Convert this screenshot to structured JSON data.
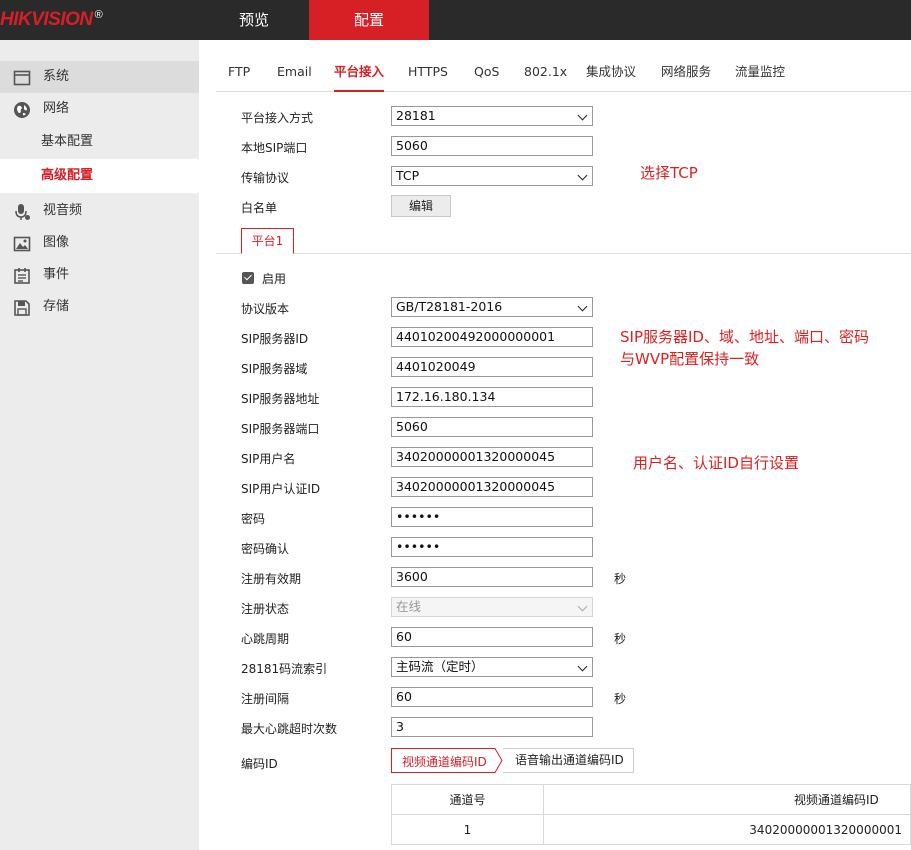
{
  "header": {
    "logo": "HIKVISION",
    "logo_mark": "®",
    "tabs": [
      {
        "label": "预览"
      },
      {
        "label": "配置"
      }
    ]
  },
  "sidebar": {
    "items": [
      {
        "label": "系统",
        "icon": "window-icon"
      },
      {
        "label": "网络",
        "icon": "globe-icon"
      },
      {
        "label": "基本配置"
      },
      {
        "label": "高级配置"
      },
      {
        "label": "视音频",
        "icon": "microphone-icon"
      },
      {
        "label": "图像",
        "icon": "image-icon"
      },
      {
        "label": "事件",
        "icon": "calendar-icon"
      },
      {
        "label": "存储",
        "icon": "floppy-disk-icon"
      }
    ]
  },
  "subtabs": [
    "FTP",
    "Email",
    "平台接入",
    "HTTPS",
    "QoS",
    "802.1x",
    "集成协议",
    "网络服务",
    "流量监控"
  ],
  "form": {
    "access_mode": {
      "label": "平台接入方式",
      "value": "28181"
    },
    "local_sip_port": {
      "label": "本地SIP端口",
      "value": "5060"
    },
    "transport": {
      "label": "传输协议",
      "value": "TCP"
    },
    "whitelist": {
      "label": "白名单",
      "button": "编辑"
    },
    "platform_tab": "平台1",
    "enable": {
      "label": "启用"
    },
    "protocol_version": {
      "label": "协议版本",
      "value": "GB/T28181-2016"
    },
    "sip_server_id": {
      "label": "SIP服务器ID",
      "value": "44010200492000000001"
    },
    "sip_server_domain": {
      "label": "SIP服务器域",
      "value": "4401020049"
    },
    "sip_server_address": {
      "label": "SIP服务器地址",
      "value": "172.16.180.134"
    },
    "sip_server_port": {
      "label": "SIP服务器端口",
      "value": "5060"
    },
    "sip_username": {
      "label": "SIP用户名",
      "value": "34020000001320000045"
    },
    "sip_auth_id": {
      "label": "SIP用户认证ID",
      "value": "34020000001320000045"
    },
    "password": {
      "label": "密码",
      "value": "••••••"
    },
    "password_confirm": {
      "label": "密码确认",
      "value": "••••••"
    },
    "register_validity": {
      "label": "注册有效期",
      "value": "3600",
      "unit": "秒"
    },
    "register_status": {
      "label": "注册状态",
      "value": "在线"
    },
    "heartbeat_period": {
      "label": "心跳周期",
      "value": "60",
      "unit": "秒"
    },
    "stream_index": {
      "label": "28181码流索引",
      "value": "主码流（定时）"
    },
    "register_interval": {
      "label": "注册间隔",
      "value": "60",
      "unit": "秒"
    },
    "max_heartbeat_timeout": {
      "label": "最大心跳超时次数",
      "value": "3"
    },
    "encoding_id": {
      "label": "编码ID"
    }
  },
  "channel_tabs": [
    "视频通道编码ID",
    "语音输出通道编码ID"
  ],
  "channel_table": {
    "headers": [
      "通道号",
      "视频通道编码ID"
    ],
    "rows": [
      [
        "1",
        "34020000001320000001"
      ]
    ]
  },
  "annotations": {
    "tcp": "选择TCP",
    "sip_line1": "SIP服务器ID、域、地址、端口、密码",
    "sip_line2": "与WVP配置保持一致",
    "user": "用户名、认证ID自行设置"
  },
  "colors": {
    "accent": "#d71f26",
    "annotation": "#e02020",
    "topbar": "#2a2a2a",
    "sidebar": "#ececec"
  }
}
